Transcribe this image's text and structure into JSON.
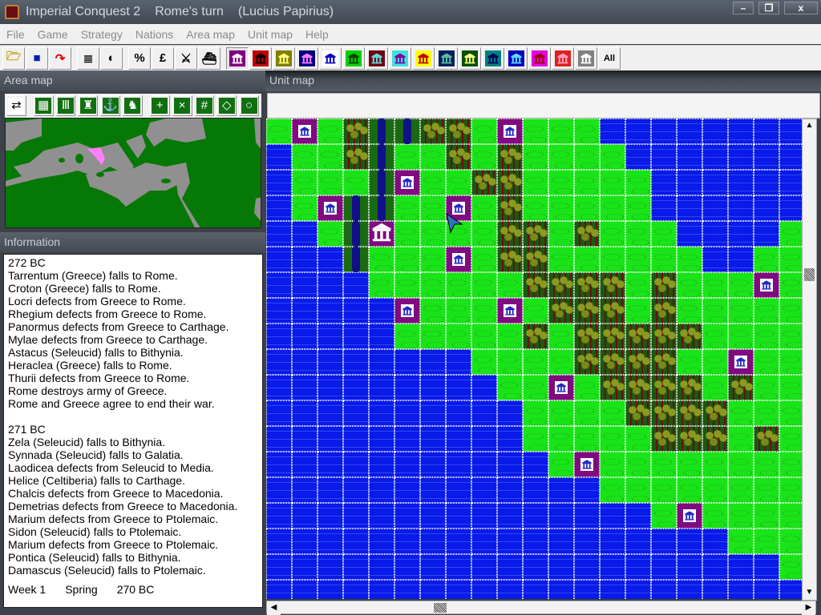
{
  "window": {
    "app_title": "Imperial Conquest 2",
    "turn": "Rome's turn",
    "leader": "(Lucius Papirius)",
    "minimize": "–",
    "restore": "❐",
    "close": "x"
  },
  "menu": [
    "File",
    "Game",
    "Strategy",
    "Nations",
    "Area map",
    "Unit map",
    "Help"
  ],
  "toolbar": {
    "tools": [
      {
        "name": "open-folder-icon",
        "glyph": "🗁",
        "color": "#c8a000"
      },
      {
        "name": "save-disk-icon",
        "glyph": "■",
        "color": "#0020c0"
      },
      {
        "name": "undo-arrow-icon",
        "glyph": "↷",
        "color": "#e00000"
      },
      {
        "name": "list-lines-icon",
        "glyph": "≣",
        "color": "#000000"
      },
      {
        "name": "contrast-icon",
        "glyph": "◐",
        "color": "#000000"
      },
      {
        "name": "percent-icon",
        "glyph": "%",
        "color": "#000000"
      },
      {
        "name": "pound-icon",
        "glyph": "£",
        "color": "#000000"
      },
      {
        "name": "crossed-swords-icon",
        "glyph": "⚔",
        "color": "#000000"
      },
      {
        "name": "ship-icon",
        "glyph": "⛴",
        "color": "#000000"
      }
    ],
    "nations": [
      {
        "bg": "#800080",
        "fg": "#ffffff"
      },
      {
        "bg": "#c00000",
        "fg": "#000000"
      },
      {
        "bg": "#808000",
        "fg": "#ffff80"
      },
      {
        "bg": "#000080",
        "fg": "#ff80ff"
      },
      {
        "bg": "#ffffff",
        "fg": "#0000c0"
      },
      {
        "bg": "#00d000",
        "fg": "#004000"
      },
      {
        "bg": "#700010",
        "fg": "#60e0e0"
      },
      {
        "bg": "#40e0e0",
        "fg": "#8000a0"
      },
      {
        "bg": "#ffff00",
        "fg": "#c00000"
      },
      {
        "bg": "#002060",
        "fg": "#60c0a0"
      },
      {
        "bg": "#005000",
        "fg": "#ffff80"
      },
      {
        "bg": "#008080",
        "fg": "#000060"
      },
      {
        "bg": "#0000c0",
        "fg": "#60e0ff"
      },
      {
        "bg": "#e000e0",
        "fg": "#a00000"
      },
      {
        "bg": "#e02020",
        "fg": "#ffa0c0"
      },
      {
        "bg": "#808080",
        "fg": "#ffffff"
      }
    ],
    "all_label": "All"
  },
  "area_map": {
    "title": "Area map",
    "tools": [
      {
        "name": "map-swap-icon",
        "glyph": "⇄"
      },
      {
        "name": "building-icon",
        "glyph": "▦"
      },
      {
        "name": "temple-icon",
        "glyph": "Ⅲ"
      },
      {
        "name": "soldier-icon",
        "glyph": "♜"
      },
      {
        "name": "ship-icon",
        "glyph": "⚓"
      },
      {
        "name": "units-icon",
        "glyph": "♞"
      },
      {
        "name": "plus-grid-icon",
        "glyph": "+"
      },
      {
        "name": "cross-grid-icon",
        "glyph": "×"
      },
      {
        "name": "hash-grid-icon",
        "glyph": "#"
      },
      {
        "name": "diamond-icon",
        "glyph": "◇"
      },
      {
        "name": "circle-icon",
        "glyph": "○"
      }
    ],
    "colors": {
      "land": "#067806",
      "sea": "#909090",
      "selected": "#ff80ff"
    }
  },
  "information": {
    "title": "Information",
    "lines": [
      "272 BC",
      "Tarrentum (Greece) falls to Rome.",
      "Croton (Greece) falls to Rome.",
      "Locri defects from Greece to Rome.",
      "Rhegium defects from Greece to Rome.",
      "Panormus defects from Greece to Carthage.",
      "Mylae defects from Greece to Carthage.",
      "Astacus (Seleucid) falls to Bithynia.",
      "Heraclea (Greece) falls to Rome.",
      "Thurii defects from Greece to Rome.",
      "Rome destroys army of Greece.",
      "Rome and Greece agree to end their war.",
      "",
      "271 BC",
      "Zela (Seleucid) falls to Bithynia.",
      "Synnada (Seleucid) falls to Galatia.",
      "Laodicea defects from Seleucid to Media.",
      "Helice (Celtiberia) falls to Carthage.",
      "Chalcis defects from Greece to Macedonia.",
      "Demetrias defects from Greece to Macedonia.",
      "Marium defects from Greece to Ptolemaic.",
      "Sidon (Seleucid) falls to Ptolemaic.",
      "Marium defects from Greece to Ptolemaic.",
      "Pontica (Seleucid) falls to Bithynia.",
      "Damascus (Seleucid) falls to Ptolemaic."
    ],
    "status": {
      "week": "Week 1",
      "season": "Spring",
      "year": "270 BC"
    }
  },
  "unit_map": {
    "title": "Unit map",
    "legend": {
      "W": "sea",
      "G": "grassland",
      "F": "forest",
      "R": "river",
      "T": "town",
      "C": "capital"
    },
    "rows": [
      "GTGFRRFFGTGGGWWWWWWWW",
      "WGGFRGGFGFGGGGWWWWWWW",
      "WGGGRTGGFFGGGGGWWWWWW",
      "WGTRRGGTGFGGGGGWWWWWW",
      "WWGRCGGGGFFGFGGGWWWWG",
      "WWWRGGGTGFFGGGGGGWWGG",
      "WWWWGGGGGGFFFFGFGGGTG",
      "WWWWWTGGGTGFFFGFGGGGG",
      "WWWWWGGGGGFGFFFFFGGGG",
      "WWWWWWWWGGGGFFFFGGTGG",
      "WWWWWWWWWGGTGFFFFGFGG",
      "WWWWWWWWWWGGGGFFFFGGG",
      "WWWWWWWWWWGGGGGFFFGFG",
      "WWWWWWWWWWWGTGGGGGGGG",
      "WWWWWWWWWWWWWGGGGGGGG",
      "WWWWWWWWWWWWWWWGTGGGG",
      "WWWWWWWWWWWWWWWWWWGGG",
      "WWWWWWWWWWWWWWWWWWWWG",
      "WWWWWWWWWWWWWWWWWWWWW"
    ]
  }
}
